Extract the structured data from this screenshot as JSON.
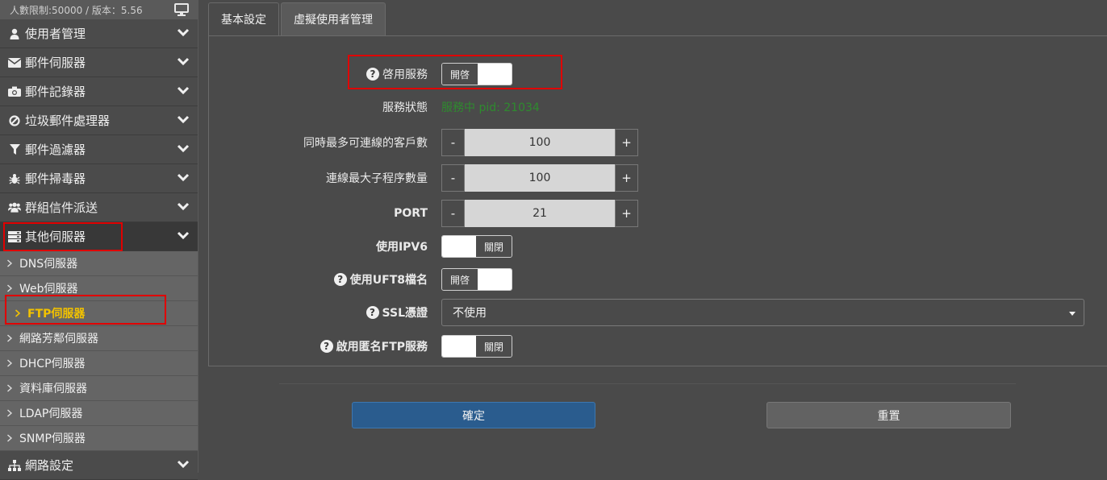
{
  "license": {
    "text": "人數限制:50000 / 版本：5.56",
    "icon": "monitor-icon"
  },
  "sidebar": {
    "categories_top": [
      {
        "label": "使用者管理",
        "icon": "user-icon"
      },
      {
        "label": "郵件伺服器",
        "icon": "envelope-icon"
      },
      {
        "label": "郵件記錄器",
        "icon": "camera-icon"
      },
      {
        "label": "垃圾郵件處理器",
        "icon": "ban-icon"
      },
      {
        "label": "郵件過濾器",
        "icon": "filter-icon"
      },
      {
        "label": "郵件掃毒器",
        "icon": "bug-icon"
      },
      {
        "label": "群組信件派送",
        "icon": "users-icon"
      }
    ],
    "active_category": {
      "label": "其他伺服器",
      "icon": "server-icon"
    },
    "subitems": [
      {
        "label": "DNS伺服器"
      },
      {
        "label": "Web伺服器"
      },
      {
        "label": "FTP伺服器",
        "active": true
      },
      {
        "label": "網路芳鄰伺服器"
      },
      {
        "label": "DHCP伺服器"
      },
      {
        "label": "資料庫伺服器"
      },
      {
        "label": "LDAP伺服器"
      },
      {
        "label": "SNMP伺服器"
      }
    ],
    "categories_bottom": [
      {
        "label": "網路設定",
        "icon": "sitemap-icon"
      }
    ]
  },
  "tabs": [
    {
      "label": "基本設定",
      "active": true
    },
    {
      "label": "虛擬使用者管理",
      "active": false
    }
  ],
  "form": {
    "enable_service": {
      "label": "啓用服務",
      "toggle": "開啓",
      "on": true
    },
    "service_status": {
      "label": "服務狀態",
      "value": "服務中 pid: 21034"
    },
    "max_clients": {
      "label": "同時最多可連線的客戶數",
      "value": "100",
      "minus": "-",
      "plus": "+"
    },
    "max_children": {
      "label": "連線最大子程序數量",
      "value": "100",
      "minus": "-",
      "plus": "+"
    },
    "port": {
      "label": "PORT",
      "value": "21",
      "minus": "-",
      "plus": "+"
    },
    "ipv6": {
      "label": "使用IPV6",
      "toggle": "關閉",
      "on": false
    },
    "utf8": {
      "label": "使用UFT8檔名",
      "toggle": "開啓",
      "on": true
    },
    "ssl": {
      "label": "SSL憑證",
      "selected": "不使用"
    },
    "anonymous": {
      "label": "啟用匿名FTP服務",
      "toggle": "關閉",
      "on": false
    }
  },
  "actions": {
    "confirm": "確定",
    "reset": "重置"
  },
  "colors": {
    "highlight_box": "#e00000",
    "active_subitem": "#f2c200",
    "status_ok": "#2e8b2e",
    "primary_button": "#2a5c8e"
  }
}
